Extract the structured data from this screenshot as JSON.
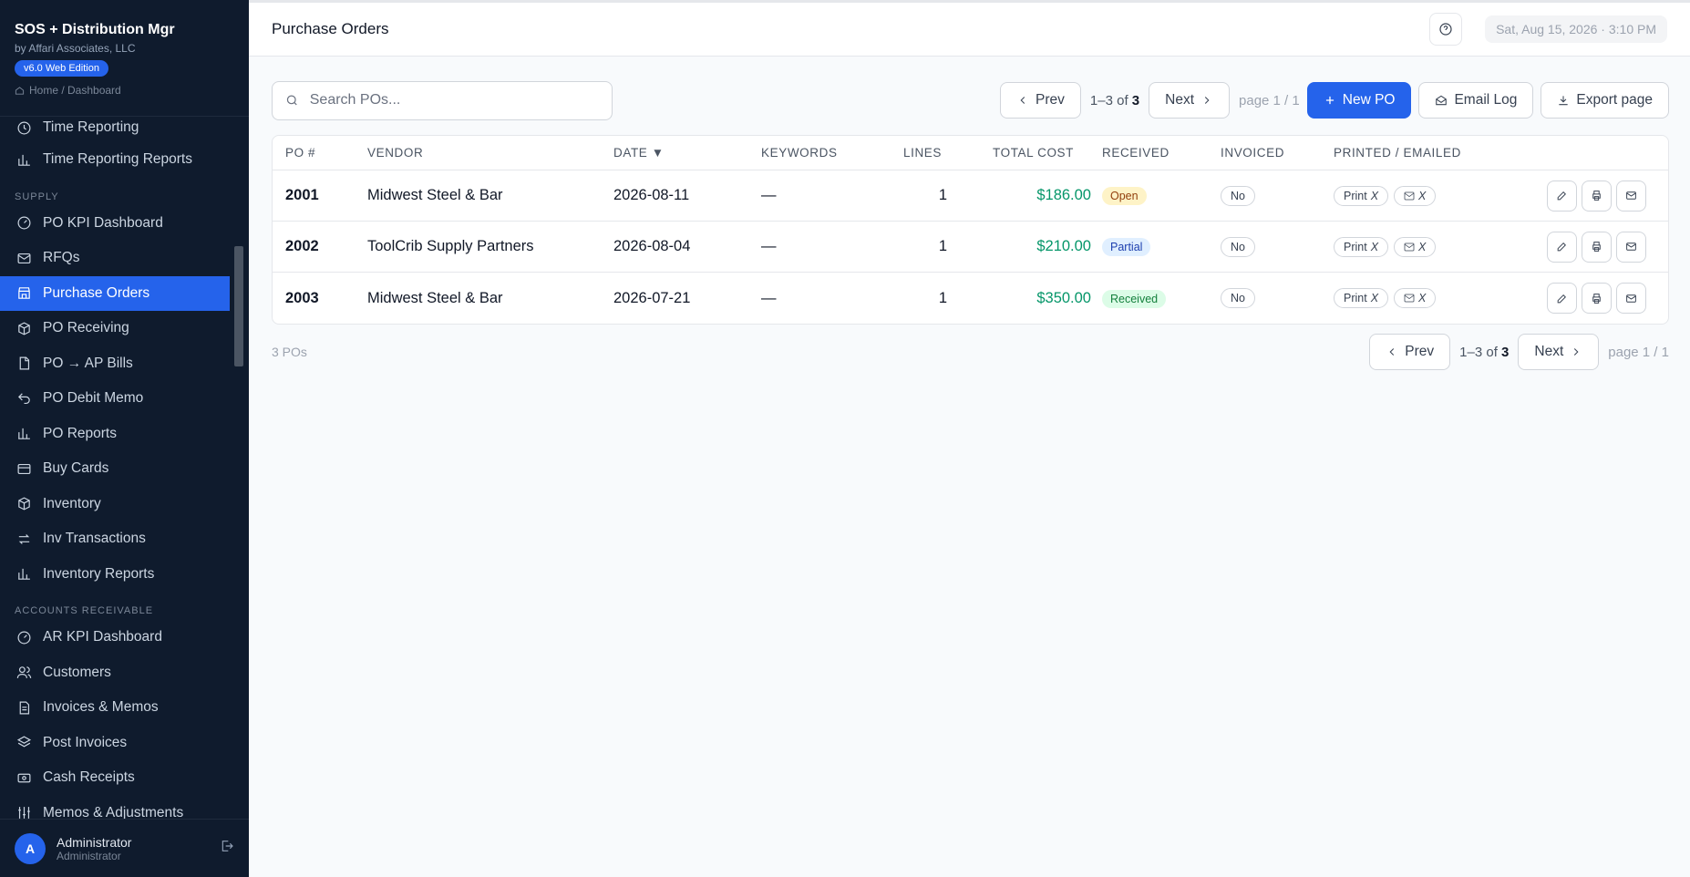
{
  "brand": {
    "app_name": "SOS + Distribution Mgr",
    "by": "by Affari Associates, LLC",
    "edition": "v6.0 Web Edition",
    "breadcrumb": "Home / Dashboard"
  },
  "sidebar": {
    "items_top": [
      {
        "label": "Time Reporting",
        "icon": "clock-icon"
      },
      {
        "label": "Time Reporting Reports",
        "icon": "bar-chart-icon"
      }
    ],
    "section_supply": "SUPPLY",
    "items_supply": [
      {
        "label": "PO KPI Dashboard",
        "icon": "gauge-icon"
      },
      {
        "label": "RFQs",
        "icon": "mail-icon"
      },
      {
        "label": "Purchase Orders",
        "icon": "store-icon",
        "active": true
      },
      {
        "label": "PO Receiving",
        "icon": "box-icon"
      },
      {
        "label": "PO → AP Bills",
        "icon": "document-icon"
      },
      {
        "label": "PO Debit Memo",
        "icon": "undo-icon"
      },
      {
        "label": "PO Reports",
        "icon": "bar-chart-icon"
      },
      {
        "label": "Buy Cards",
        "icon": "card-icon"
      },
      {
        "label": "Inventory",
        "icon": "cube-icon"
      },
      {
        "label": "Inv Transactions",
        "icon": "arrows-icon"
      },
      {
        "label": "Inventory Reports",
        "icon": "bar-chart-icon"
      }
    ],
    "section_ar": "ACCOUNTS RECEIVABLE",
    "items_ar": [
      {
        "label": "AR KPI Dashboard",
        "icon": "gauge-icon"
      },
      {
        "label": "Customers",
        "icon": "users-icon"
      },
      {
        "label": "Invoices & Memos",
        "icon": "invoice-icon"
      },
      {
        "label": "Post Invoices",
        "icon": "layers-icon"
      },
      {
        "label": "Cash Receipts",
        "icon": "receipt-icon"
      },
      {
        "label": "Memos & Adjustments",
        "icon": "sliders-icon"
      }
    ]
  },
  "user": {
    "initial": "A",
    "name": "Administrator",
    "role": "Administrator"
  },
  "header": {
    "title": "Purchase Orders",
    "datetime": "Sat, Aug 15, 2026 · 3:10 PM"
  },
  "search": {
    "placeholder": "Search POs..."
  },
  "pager": {
    "prev": "Prev",
    "next": "Next",
    "range_prefix": "1–3 of",
    "total": "3",
    "page": "page 1 / 1"
  },
  "toolbar": {
    "new_po": "New PO",
    "email_log": "Email Log",
    "export": "Export page"
  },
  "table": {
    "headers": {
      "po": "PO #",
      "vendor": "VENDOR",
      "date": "DATE ▼",
      "keywords": "KEYWORDS",
      "lines": "LINES",
      "total_cost": "TOTAL COST",
      "received": "RECEIVED",
      "invoiced": "INVOICED",
      "printed": "PRINTED / EMAILED"
    },
    "rows": [
      {
        "po": "2001",
        "vendor": "Midwest Steel & Bar",
        "date": "2026-08-11",
        "keywords": "—",
        "lines": "1",
        "total_cost": "$186.00",
        "received": "Open",
        "invoiced": "No",
        "print": "Print",
        "print_mark": "X",
        "email_mark": "X"
      },
      {
        "po": "2002",
        "vendor": "ToolCrib Supply Partners",
        "date": "2026-08-04",
        "keywords": "—",
        "lines": "1",
        "total_cost": "$210.00",
        "received": "Partial",
        "invoiced": "No",
        "print": "Print",
        "print_mark": "X",
        "email_mark": "X"
      },
      {
        "po": "2003",
        "vendor": "Midwest Steel & Bar",
        "date": "2026-07-21",
        "keywords": "—",
        "lines": "1",
        "total_cost": "$350.00",
        "received": "Received",
        "invoiced": "No",
        "print": "Print",
        "print_mark": "X",
        "email_mark": "X"
      }
    ]
  },
  "footer": {
    "count": "3 POs"
  }
}
